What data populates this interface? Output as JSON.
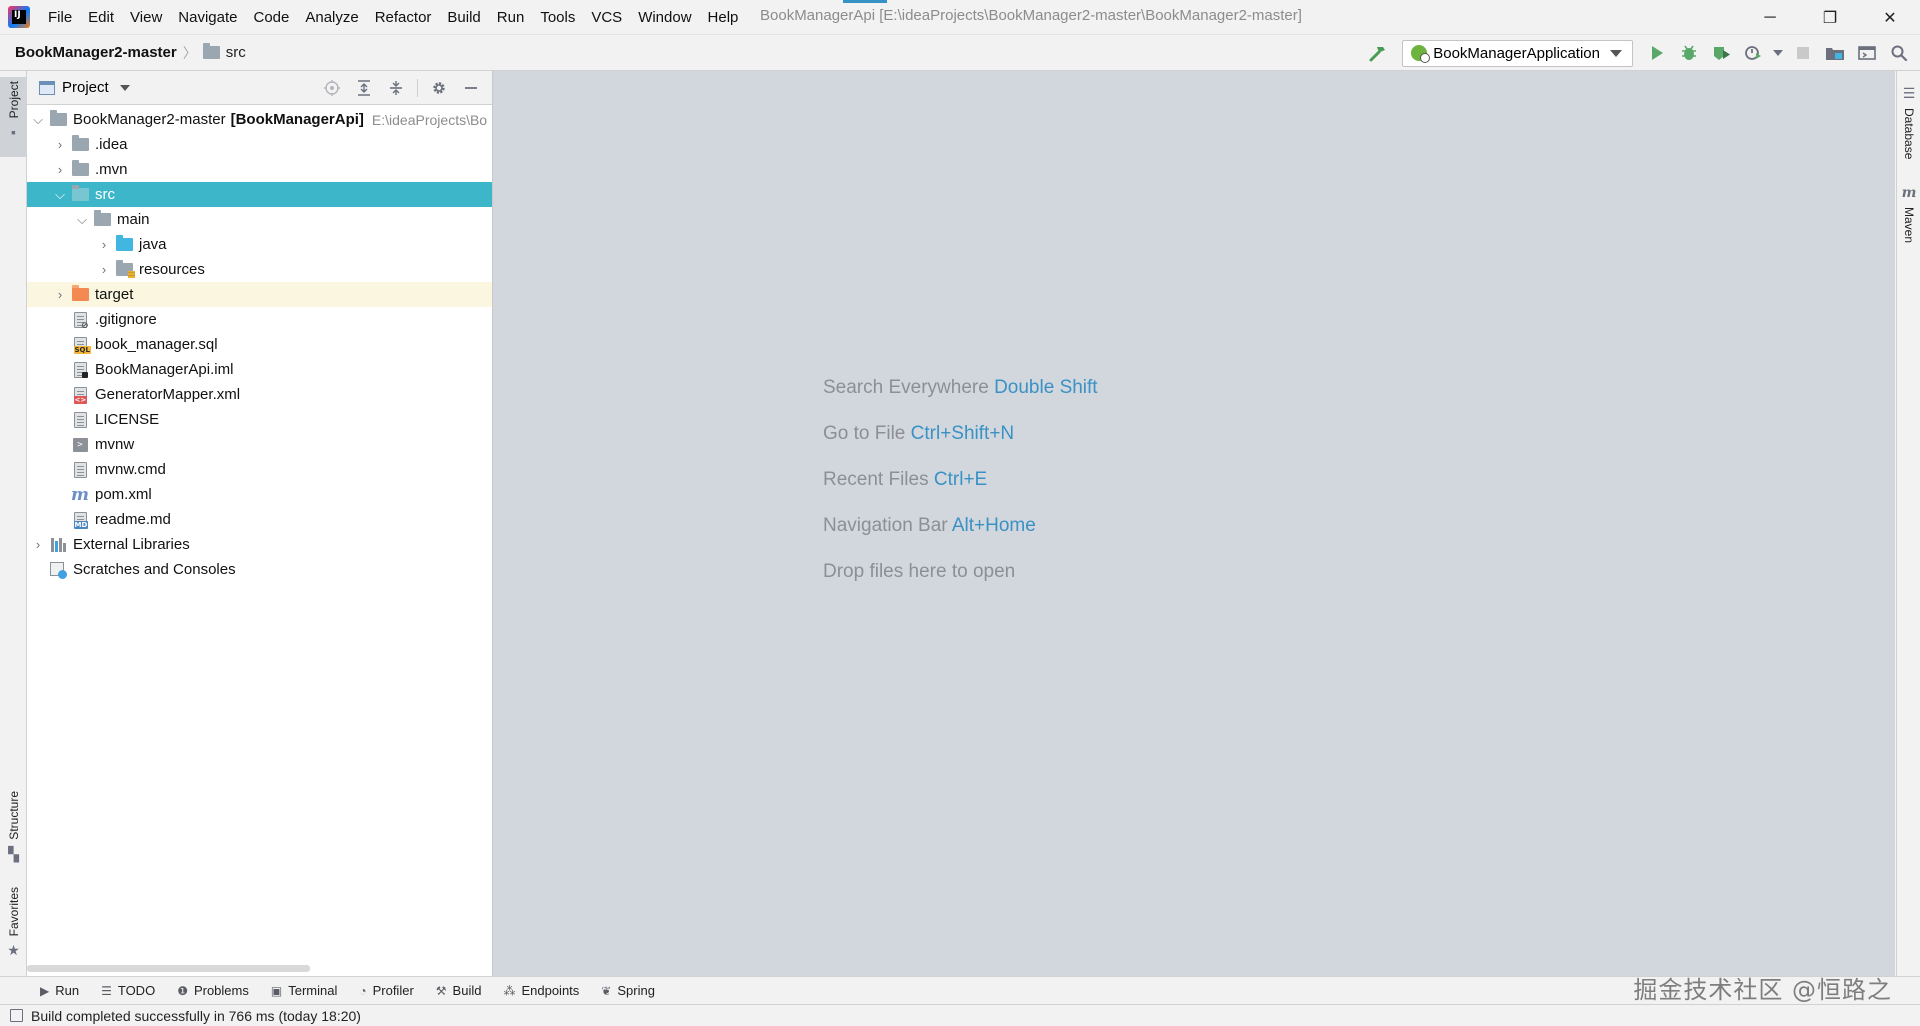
{
  "window": {
    "title": "BookManagerApi [E:\\ideaProjects\\BookManager2-master\\BookManager2-master]",
    "controls": {
      "minimize": "─",
      "restore": "❐",
      "close": "✕"
    }
  },
  "menu": [
    "File",
    "Edit",
    "View",
    "Navigate",
    "Code",
    "Analyze",
    "Refactor",
    "Build",
    "Run",
    "Tools",
    "VCS",
    "Window",
    "Help"
  ],
  "navbar": {
    "root": "BookManager2-master",
    "folder": "src",
    "run_config": "BookManagerApplication"
  },
  "left_strip": {
    "project": "Project",
    "structure": "Structure",
    "favorites": "Favorites"
  },
  "right_strip": {
    "database": "Database",
    "maven": "Maven"
  },
  "project_panel": {
    "title": "Project",
    "tree": {
      "root_name": "BookManager2-master",
      "root_module": "[BookManagerApi]",
      "root_path": "E:\\ideaProjects\\Bo",
      "idea": ".idea",
      "mvn": ".mvn",
      "src": "src",
      "main": "main",
      "java": "java",
      "resources": "resources",
      "target": "target",
      "gitignore": ".gitignore",
      "sql": "book_manager.sql",
      "iml": "BookManagerApi.iml",
      "generator": "GeneratorMapper.xml",
      "license": "LICENSE",
      "mvnw": "mvnw",
      "mvnwcmd": "mvnw.cmd",
      "pom": "pom.xml",
      "readme": "readme.md",
      "external": "External Libraries",
      "scratches": "Scratches and Consoles"
    }
  },
  "editor_hints": [
    {
      "text": "Search Everywhere",
      "shortcut": "Double Shift"
    },
    {
      "text": "Go to File",
      "shortcut": "Ctrl+Shift+N"
    },
    {
      "text": "Recent Files",
      "shortcut": "Ctrl+E"
    },
    {
      "text": "Navigation Bar",
      "shortcut": "Alt+Home"
    },
    {
      "text": "Drop files here to open",
      "shortcut": ""
    }
  ],
  "bottom_tools": [
    "Run",
    "TODO",
    "Problems",
    "Terminal",
    "Profiler",
    "Build",
    "Endpoints",
    "Spring"
  ],
  "watermark": "掘金技术社区 @恒路之",
  "status": "Build completed successfully in 766 ms (today 18:20)",
  "colors": {
    "selection": "#3eb6c9",
    "shortcut": "#3a91c4",
    "editor_bg": "#d2d7de",
    "excluded_bg": "#fbf6df"
  }
}
